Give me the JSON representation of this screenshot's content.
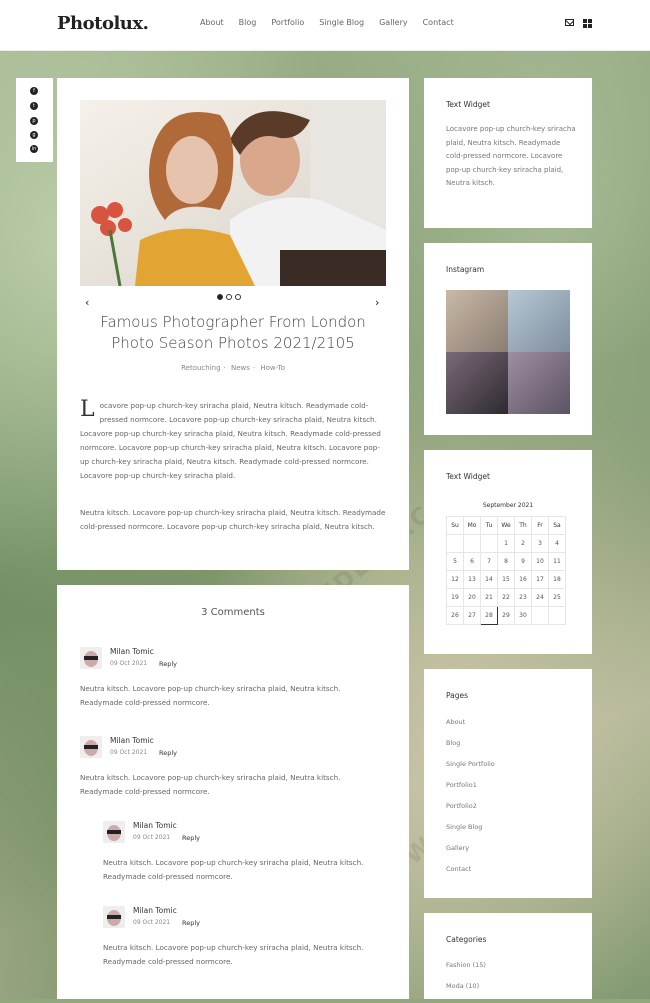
{
  "header": {
    "logo": "Photolux.",
    "nav": [
      "About",
      "Blog",
      "Portfolio",
      "Single Blog",
      "Gallery",
      "Contact"
    ],
    "icons": [
      "mail-icon",
      "grid-icon"
    ]
  },
  "social": [
    "facebook-icon",
    "twitter-icon",
    "pinterest-icon",
    "google-icon",
    "linkedin-icon"
  ],
  "post": {
    "title_line1": "Famous Photographer From London",
    "title_line2": "Photo Season Photos 2021/2105",
    "meta": [
      "Retouching",
      "News",
      "How-To"
    ],
    "dropcap": "L",
    "para1": "ocavore pop-up church-key sriracha plaid, Neutra kitsch. Readymade cold-pressed normcore. Locavore pop-up church-key sriracha plaid, Neutra kitsch. Locavore pop-up church-key sriracha plaid, Neutra kitsch. Readymade cold-pressed normcore. Locavore pop-up church-key sriracha plaid, Neutra kitsch. Locavore pop-up church-key sriracha plaid, Neutra kitsch. Readymade cold-pressed normcore. Locavore pop-up church-key sriracha plaid.",
    "para2": "Neutra kitsch. Locavore pop-up church-key sriracha plaid, Neutra kitsch. Readymade cold-pressed normcore. Locavore pop-up church-key sriracha plaid, Neutra kitsch."
  },
  "comments": {
    "title": "3 Comments",
    "items": [
      {
        "name": "Milan Tomic",
        "date": "09 Oct 2021",
        "reply": "Reply",
        "text": "Neutra kitsch. Locavore pop-up church-key sriracha plaid, Neutra kitsch. Readymade cold-pressed normcore."
      },
      {
        "name": "Milan Tomic",
        "date": "09 Oct 2021",
        "reply": "Reply",
        "text": "Neutra kitsch. Locavore pop-up church-key sriracha plaid, Neutra kitsch. Readymade cold-pressed normcore."
      },
      {
        "name": "Milan Tomic",
        "date": "09 Oct 2021",
        "reply": "Reply",
        "text": "Neutra kitsch. Locavore pop-up church-key sriracha plaid, Neutra kitsch. Readymade cold-pressed normcore."
      },
      {
        "name": "Milan Tomic",
        "date": "09 Oct 2021",
        "reply": "Reply",
        "text": "Neutra kitsch. Locavore pop-up church-key sriracha plaid, Neutra kitsch. Readymade cold-pressed normcore."
      }
    ]
  },
  "sidebar": {
    "text_widget": {
      "title": "Text Widget",
      "text": "Locavore pop-up church-key sriracha plaid, Neutra kitsch. Readymade cold-pressed normcore. Locavore pop-up church-key sriracha plaid, Neutra kitsch."
    },
    "instagram": {
      "title": "Instagram"
    },
    "calendar": {
      "title": "Text Widget",
      "month": "September 2021",
      "days": [
        "Su",
        "Mo",
        "Tu",
        "We",
        "Th",
        "Fr",
        "Sa"
      ],
      "weeks": [
        [
          "",
          "",
          "",
          "1",
          "2",
          "3",
          "4"
        ],
        [
          "5",
          "6",
          "7",
          "8",
          "9",
          "10",
          "11"
        ],
        [
          "12",
          "13",
          "14",
          "15",
          "16",
          "17",
          "18"
        ],
        [
          "19",
          "20",
          "21",
          "22",
          "23",
          "24",
          "25"
        ],
        [
          "26",
          "27",
          "28",
          "29",
          "30",
          "",
          ""
        ]
      ],
      "today": "28"
    },
    "pages": {
      "title": "Pages",
      "items": [
        "About",
        "Blog",
        "Single Portfolio",
        "Portfolio1",
        "Portfolio2",
        "Single Blog",
        "Gallery",
        "Contact"
      ]
    },
    "categories": {
      "title": "Categories",
      "items": [
        "Fashion (15)",
        "Moda (10)"
      ]
    }
  },
  "watermark": "WWW.DOWNDEMO.COM"
}
